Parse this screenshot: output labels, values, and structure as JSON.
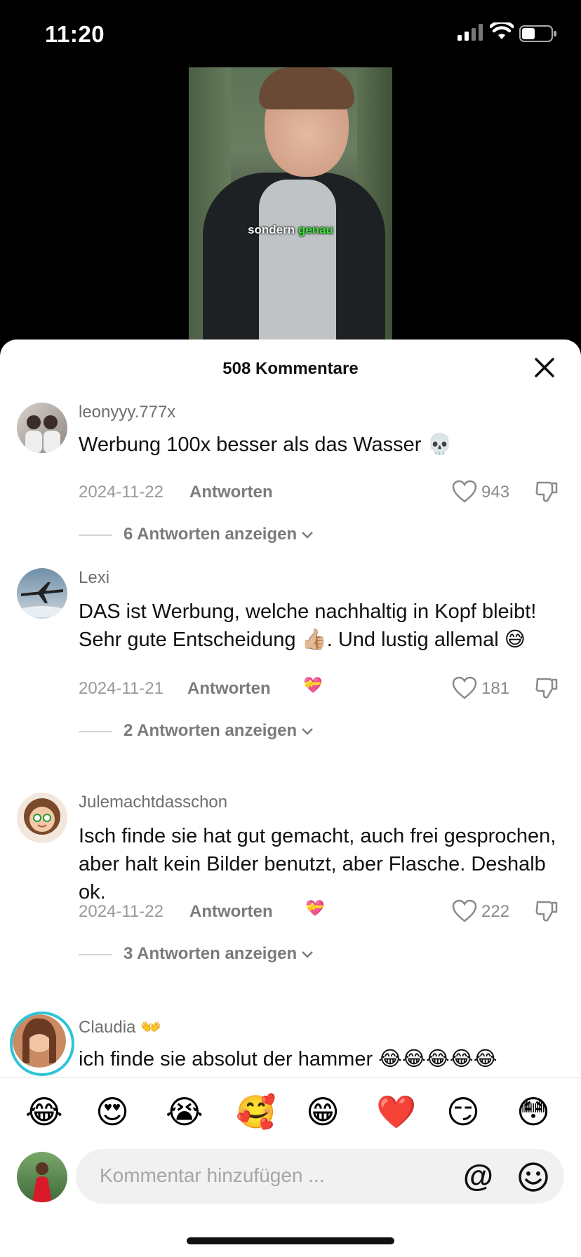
{
  "status": {
    "time": "11:20"
  },
  "video": {
    "caption_word1": "sondern",
    "caption_word2": "genau"
  },
  "sheet": {
    "title": "508 Kommentare"
  },
  "comments": [
    {
      "username": "leonyyy.777x",
      "text": "Werbung 100x besser als das Wasser 💀",
      "date": "2024-11-22",
      "reply": "Antworten",
      "likes": "943",
      "replies": "6 Antworten anzeigen"
    },
    {
      "username": "Lexi",
      "text": "DAS ist Werbung, welche nachhaltig in Kopf bleibt! Sehr gute Entscheidung 👍🏼. Und lustig allemal 😅",
      "date": "2024-11-21",
      "reply": "Antworten",
      "reaction": "💝",
      "likes": "181",
      "replies": "2 Antworten anzeigen"
    },
    {
      "username": "Julemachtdasschon",
      "text": "Isch finde sie hat gut gemacht, auch frei gesprochen, aber halt kein Bilder benutzt, aber Flasche. Deshalb ok.",
      "date": "2024-11-22",
      "reply": "Antworten",
      "reaction": "💝",
      "likes": "222",
      "replies": "3 Antworten anzeigen"
    },
    {
      "username": "Claudia 👐",
      "text": "ich finde sie absolut der hammer 😂😂😂😂😂"
    }
  ],
  "emojis": [
    "😂",
    "😍",
    "😭",
    "🥰",
    "😁",
    "❤️",
    "😏",
    "😳"
  ],
  "input": {
    "placeholder": "Kommentar hinzufügen ...",
    "at": "@"
  },
  "colors": {
    "story_ring": "#2ec4d6",
    "caption_highlight": "#39e639"
  }
}
